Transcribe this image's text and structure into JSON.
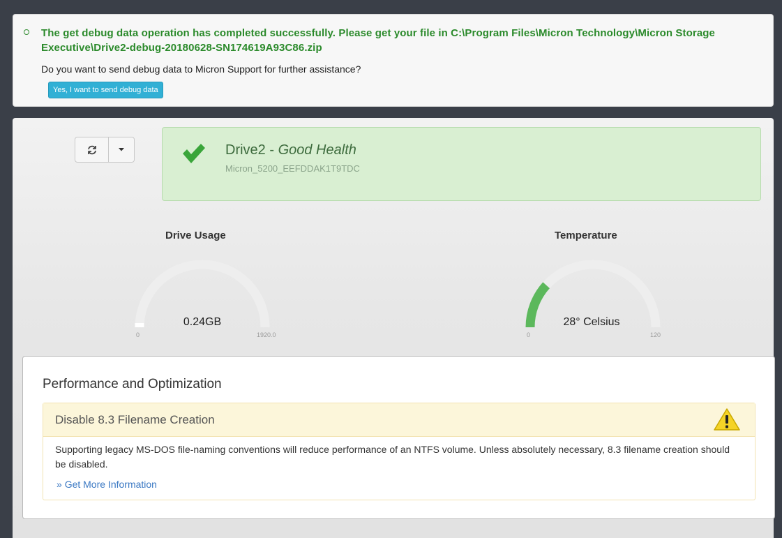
{
  "alert": {
    "message": "The get debug data operation has completed successfully. Please get your file in C:\\Program Files\\Micron Technology\\Micron Storage Executive\\Drive2-debug-20180628-SN174619A93C86.zip",
    "question": "Do you want to send debug data to Micron Support for further assistance?",
    "send_button": "Yes, I want to send debug data",
    "color": "#2b8a2b"
  },
  "toolbar": {
    "refresh_icon": "refresh-icon",
    "dropdown_icon": "caret-down-icon"
  },
  "drive": {
    "name": "Drive2",
    "separator": " - ",
    "status": "Good Health",
    "model": "Micron_5200_EEFDDAK1T9TDC",
    "status_icon": "checkmark-icon",
    "status_color": "#3aa53a"
  },
  "gauges": {
    "usage": {
      "title": "Drive Usage",
      "value_label": "0.24GB",
      "min": "0",
      "max": "1920.0",
      "value": 0.24,
      "range": [
        0,
        1920
      ]
    },
    "temperature": {
      "title": "Temperature",
      "value_label": "28° Celsius",
      "min": "0",
      "max": "120",
      "value": 28,
      "range": [
        0,
        120
      ],
      "fill_color": "#5cb85c"
    }
  },
  "performance": {
    "title": "Performance and Optimization",
    "items": [
      {
        "title": "Disable 8.3 Filename Creation",
        "icon": "warning-icon",
        "description": "Supporting legacy MS-DOS file-naming conventions will reduce performance of an NTFS volume. Unless absolutely necessary, 8.3 filename creation should be disabled.",
        "link_prefix": "»",
        "link": "Get More Information"
      }
    ]
  }
}
